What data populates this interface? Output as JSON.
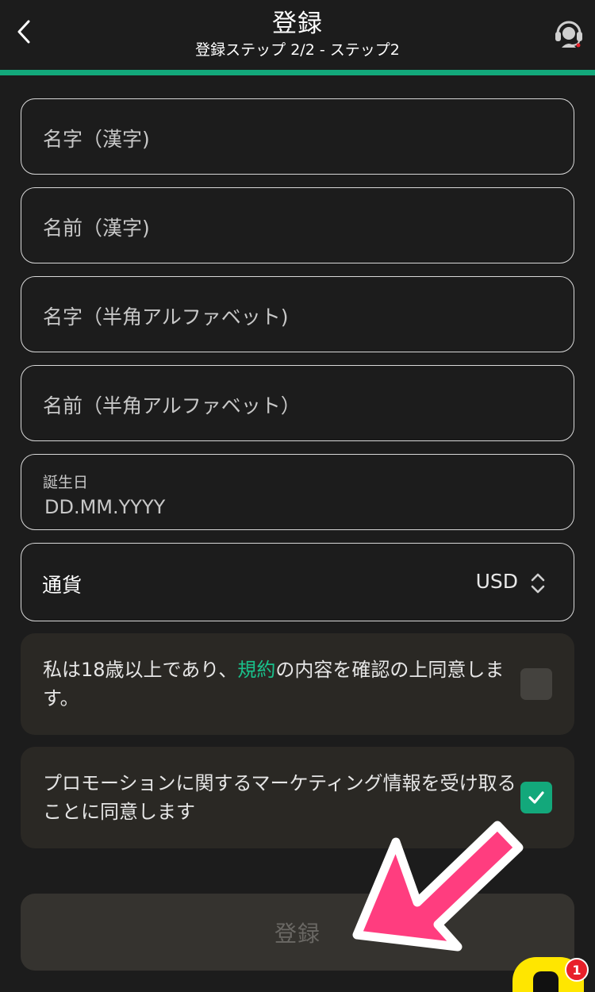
{
  "header": {
    "title": "登録",
    "subtitle": "登録ステップ 2/2 - ステップ2",
    "progress_percent": 100,
    "back_icon": "chevron-left-icon",
    "support_icon": "headset-support-icon"
  },
  "form": {
    "last_name_kanji": {
      "placeholder": "名字（漢字)"
    },
    "first_name_kanji": {
      "placeholder": "名前（漢字)"
    },
    "last_name_alpha": {
      "placeholder": "名字（半角アルファベット)"
    },
    "first_name_alpha": {
      "placeholder": "名前（半角アルファベット）"
    },
    "birthday": {
      "label": "誕生日",
      "placeholder": "DD.MM.YYYY"
    },
    "currency": {
      "label": "通貨",
      "value": "USD"
    }
  },
  "consents": {
    "terms": {
      "text_before": "私は18歳以上であり、",
      "link": "規約",
      "text_after": "の内容を確認の上同意します。",
      "checked": false
    },
    "marketing": {
      "text": "プロモーションに関するマーケティング情報を受け取ることに同意します",
      "checked": true
    }
  },
  "submit": {
    "label": "登録",
    "enabled": false
  },
  "chat_widget": {
    "badge_count": "1"
  },
  "colors": {
    "background": "#1c1c1c",
    "accent": "#13a87b",
    "link": "#19c08b",
    "annotation_arrow": "#ff3d7f",
    "chat_widget": "#ffe600"
  }
}
